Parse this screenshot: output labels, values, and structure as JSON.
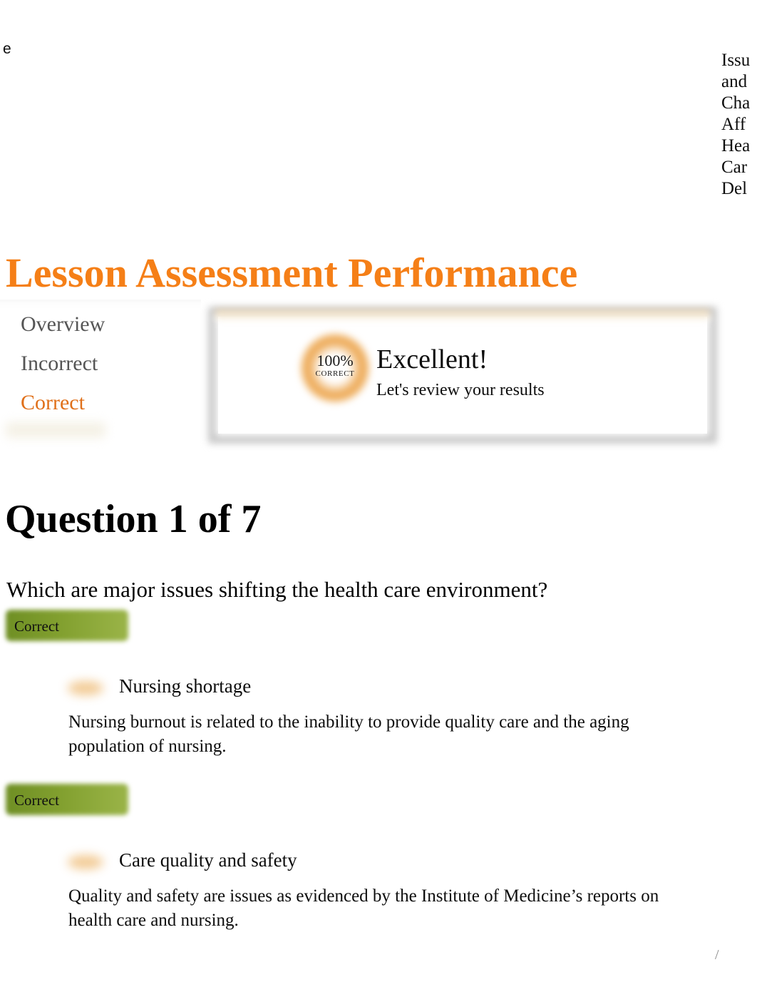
{
  "fragments": {
    "top_left": "e",
    "top_right_lines": [
      "Issu",
      "and",
      "Cha",
      "Aff",
      "Hea",
      "Car",
      "Del"
    ],
    "page_slash": "/"
  },
  "page": {
    "title": "Lesson Assessment Performance",
    "title_color": "#f57f17"
  },
  "tabs": {
    "items": [
      {
        "label": "Overview",
        "active": false
      },
      {
        "label": "Incorrect",
        "active": false
      },
      {
        "label": "Correct",
        "active": true
      }
    ],
    "active_color": "#e0701a",
    "inactive_color": "#555555"
  },
  "result_card": {
    "score_percent": "100%",
    "score_label": "CORRECT",
    "headline": "Excellent!",
    "subtext": "Let's review your results",
    "accent_color": "#eba044"
  },
  "question": {
    "heading": "Question 1 of 7",
    "prompt": "Which are major issues shifting the health care environment?",
    "answers": [
      {
        "verdict": "Correct",
        "title": "Nursing shortage",
        "description": "Nursing burnout is related to the inability to provide quality care and the aging population of nursing."
      },
      {
        "verdict": "Correct",
        "title": "Care quality and safety",
        "description": "Quality and safety are issues as evidenced by the Institute of Medicine’s reports on health care and nursing."
      }
    ],
    "verdict_color": "#82a02f"
  }
}
